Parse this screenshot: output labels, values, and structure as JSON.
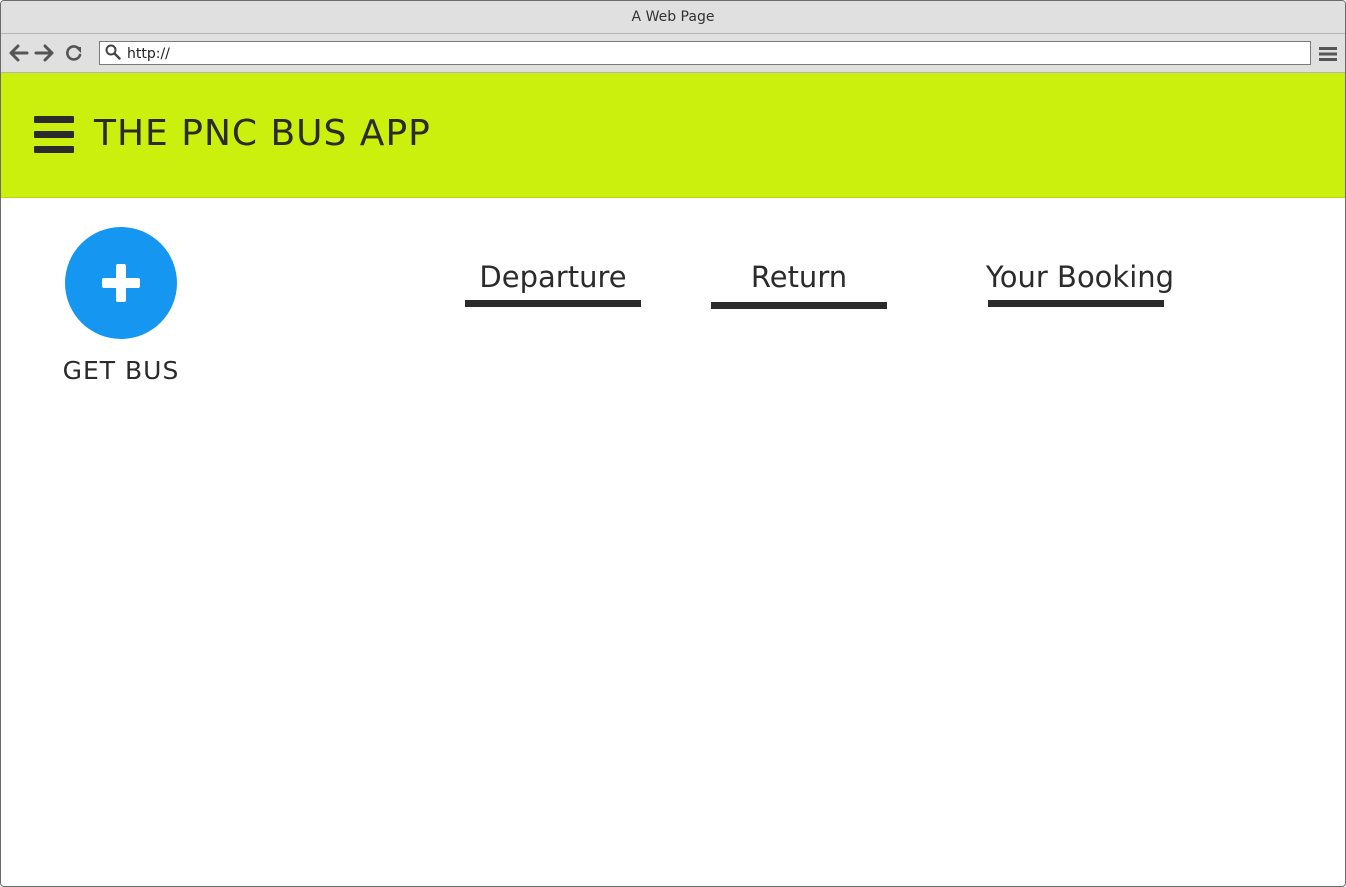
{
  "browser": {
    "window_title": "A Web Page",
    "url": "http://"
  },
  "app": {
    "title": "THE PNC BUS APP",
    "header_color": "#ccf00e",
    "accent_color": "#1596f0"
  },
  "get_bus": {
    "label": "GET BUS",
    "icon": "plus-icon"
  },
  "tabs": [
    {
      "label": "Departure"
    },
    {
      "label": "Return"
    },
    {
      "label": "Your Booking"
    }
  ],
  "icons": {
    "back": "arrow-left-icon",
    "forward": "arrow-right-icon",
    "reload": "reload-icon",
    "search": "search-icon",
    "browser_menu": "menu-icon",
    "app_menu": "hamburger-icon"
  }
}
